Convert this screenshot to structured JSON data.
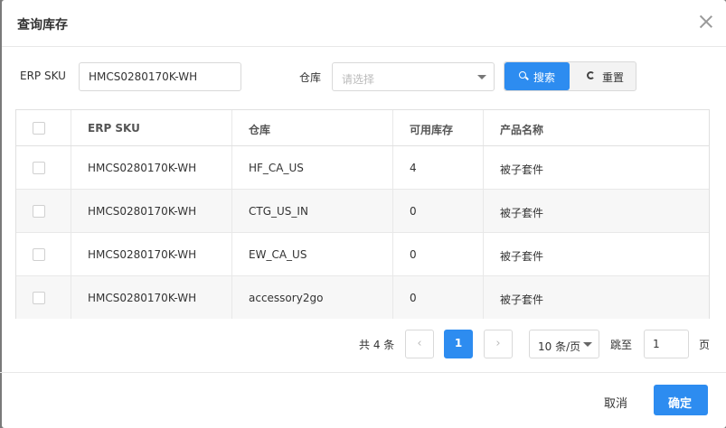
{
  "dialog": {
    "title": "查询库存"
  },
  "filters": {
    "sku_label": "ERP SKU",
    "sku_value": "HMCS0280170K-WH",
    "warehouse_label": "仓库",
    "warehouse_placeholder": "请选择",
    "search_label": "搜索",
    "reset_label": "重置"
  },
  "table": {
    "headers": [
      "ERP SKU",
      "仓库",
      "可用库存",
      "产品名称"
    ],
    "rows": [
      {
        "sku": "HMCS0280170K-WH",
        "warehouse": "HF_CA_US",
        "stock": "4",
        "name": "被子套件"
      },
      {
        "sku": "HMCS0280170K-WH",
        "warehouse": "CTG_US_IN",
        "stock": "0",
        "name": "被子套件"
      },
      {
        "sku": "HMCS0280170K-WH",
        "warehouse": "EW_CA_US",
        "stock": "0",
        "name": "被子套件"
      },
      {
        "sku": "HMCS0280170K-WH",
        "warehouse": "accessory2go",
        "stock": "0",
        "name": "被子套件"
      }
    ]
  },
  "pagination": {
    "total_text": "共 4 条",
    "current_page": "1",
    "page_size": "10 条/页",
    "jump_label": "跳至",
    "jump_value": "1",
    "page_suffix": "页"
  },
  "footer": {
    "cancel_label": "取消",
    "ok_label": "确定"
  },
  "colors": {
    "primary": "#2d8cf0",
    "border": "#d9d9d9"
  }
}
